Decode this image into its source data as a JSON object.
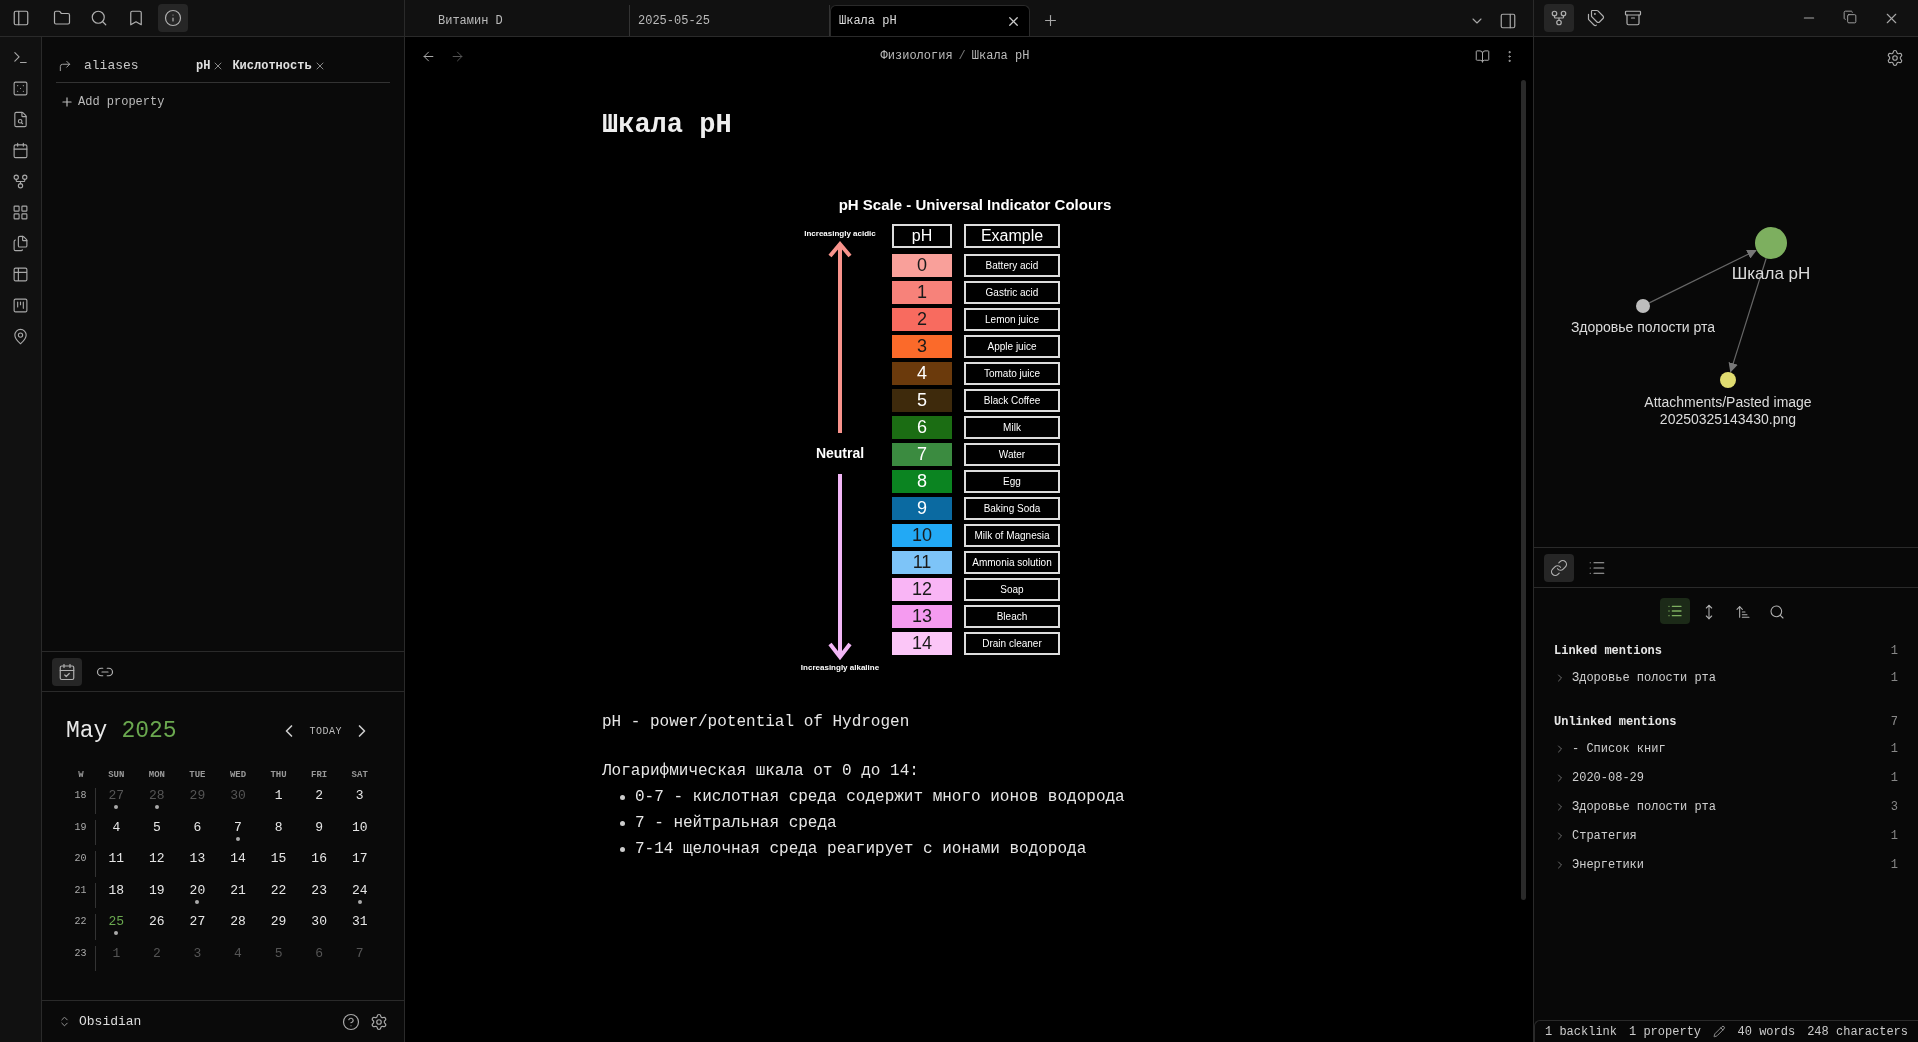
{
  "tabs": [
    {
      "label": "Витамин D",
      "selected": false
    },
    {
      "label": "2025-05-25",
      "selected": false
    },
    {
      "label": "Шкала pH",
      "selected": true
    }
  ],
  "breadcrumb": [
    "Физиология",
    "Шкала pH"
  ],
  "breadcrumb_separator": "/",
  "properties": {
    "name": "aliases",
    "values": [
      "pH",
      "Кислотность"
    ],
    "add_label": "Add property"
  },
  "note": {
    "title": "Шкала pH",
    "image": {
      "title": "pH Scale - Universal Indicator Colours",
      "headers": [
        "pH",
        "Example"
      ],
      "acid_label": "Increasingly acidic",
      "neutral_label": "Neutral",
      "alkaline_label": "Increasingly alkaline",
      "rows": [
        {
          "ph": "0",
          "example": "Battery acid",
          "color": "#f9a09a"
        },
        {
          "ph": "1",
          "example": "Gastric acid",
          "color": "#f7827a"
        },
        {
          "ph": "2",
          "example": "Lemon juice",
          "color": "#f86b5f"
        },
        {
          "ph": "3",
          "example": "Apple juice",
          "color": "#fb6a2a"
        },
        {
          "ph": "4",
          "example": "Tomato juice",
          "color": "#6b3a0c"
        },
        {
          "ph": "5",
          "example": "Black Coffee",
          "color": "#3e2a0c"
        },
        {
          "ph": "6",
          "example": "Milk",
          "color": "#1b6d13"
        },
        {
          "ph": "7",
          "example": "Water",
          "color": "#3b8b40"
        },
        {
          "ph": "8",
          "example": "Egg",
          "color": "#0b8421"
        },
        {
          "ph": "9",
          "example": "Baking Soda",
          "color": "#0b6aa1"
        },
        {
          "ph": "10",
          "example": "Milk of Magnesia",
          "color": "#22a9f5"
        },
        {
          "ph": "11",
          "example": "Ammonia solution",
          "color": "#7dc4f8"
        },
        {
          "ph": "12",
          "example": "Soap",
          "color": "#f9b5f5"
        },
        {
          "ph": "13",
          "example": "Bleach",
          "color": "#f59bf0"
        },
        {
          "ph": "14",
          "example": "Drain cleaner",
          "color": "#fbc6f7"
        }
      ]
    },
    "lines": [
      "pH - power/potential of Hydrogen",
      "Логарифмическая шкала от 0 до 14:"
    ],
    "bullets": [
      "0-7 - кислотная среда содержит много ионов водорода",
      "7 - нейтральная среда",
      "7-14 щелочная среда реагирует с ионами водорода"
    ]
  },
  "calendar": {
    "month": "May",
    "year": "2025",
    "today_label": "TODAY",
    "week_header": "W",
    "weekdays": [
      "SUN",
      "MON",
      "TUE",
      "WED",
      "THU",
      "FRI",
      "SAT"
    ],
    "weeks": [
      {
        "num": "18",
        "days": [
          {
            "label": "27",
            "muted": true,
            "dot": true,
            "today": false
          },
          {
            "label": "28",
            "muted": true,
            "dot": true,
            "today": false
          },
          {
            "label": "29",
            "muted": true,
            "dot": false,
            "today": false
          },
          {
            "label": "30",
            "muted": true,
            "dot": false,
            "today": false
          },
          {
            "label": "1",
            "muted": false,
            "dot": false,
            "today": false
          },
          {
            "label": "2",
            "muted": false,
            "dot": false,
            "today": false
          },
          {
            "label": "3",
            "muted": false,
            "dot": false,
            "today": false
          }
        ]
      },
      {
        "num": "19",
        "days": [
          {
            "label": "4",
            "muted": false,
            "dot": false,
            "today": false
          },
          {
            "label": "5",
            "muted": false,
            "dot": false,
            "today": false
          },
          {
            "label": "6",
            "muted": false,
            "dot": false,
            "today": false
          },
          {
            "label": "7",
            "muted": false,
            "dot": true,
            "today": false
          },
          {
            "label": "8",
            "muted": false,
            "dot": false,
            "today": false
          },
          {
            "label": "9",
            "muted": false,
            "dot": false,
            "today": false
          },
          {
            "label": "10",
            "muted": false,
            "dot": false,
            "today": false
          }
        ]
      },
      {
        "num": "20",
        "days": [
          {
            "label": "11",
            "muted": false,
            "dot": false,
            "today": false
          },
          {
            "label": "12",
            "muted": false,
            "dot": false,
            "today": false
          },
          {
            "label": "13",
            "muted": false,
            "dot": false,
            "today": false
          },
          {
            "label": "14",
            "muted": false,
            "dot": false,
            "today": false
          },
          {
            "label": "15",
            "muted": false,
            "dot": false,
            "today": false
          },
          {
            "label": "16",
            "muted": false,
            "dot": false,
            "today": false
          },
          {
            "label": "17",
            "muted": false,
            "dot": false,
            "today": false
          }
        ]
      },
      {
        "num": "21",
        "days": [
          {
            "label": "18",
            "muted": false,
            "dot": false,
            "today": false
          },
          {
            "label": "19",
            "muted": false,
            "dot": false,
            "today": false
          },
          {
            "label": "20",
            "muted": false,
            "dot": true,
            "today": false
          },
          {
            "label": "21",
            "muted": false,
            "dot": false,
            "today": false
          },
          {
            "label": "22",
            "muted": false,
            "dot": false,
            "today": false
          },
          {
            "label": "23",
            "muted": false,
            "dot": false,
            "today": false
          },
          {
            "label": "24",
            "muted": false,
            "dot": true,
            "today": false
          }
        ]
      },
      {
        "num": "22",
        "days": [
          {
            "label": "25",
            "muted": false,
            "dot": true,
            "today": true
          },
          {
            "label": "26",
            "muted": false,
            "dot": false,
            "today": false
          },
          {
            "label": "27",
            "muted": false,
            "dot": false,
            "today": false
          },
          {
            "label": "28",
            "muted": false,
            "dot": false,
            "today": false
          },
          {
            "label": "29",
            "muted": false,
            "dot": false,
            "today": false
          },
          {
            "label": "30",
            "muted": false,
            "dot": false,
            "today": false
          },
          {
            "label": "31",
            "muted": false,
            "dot": false,
            "today": false
          }
        ]
      },
      {
        "num": "23",
        "days": [
          {
            "label": "1",
            "muted": true,
            "dot": false,
            "today": false
          },
          {
            "label": "2",
            "muted": true,
            "dot": false,
            "today": false
          },
          {
            "label": "3",
            "muted": true,
            "dot": false,
            "today": false
          },
          {
            "label": "4",
            "muted": true,
            "dot": false,
            "today": false
          },
          {
            "label": "5",
            "muted": true,
            "dot": false,
            "today": false
          },
          {
            "label": "6",
            "muted": true,
            "dot": false,
            "today": false
          },
          {
            "label": "7",
            "muted": true,
            "dot": false,
            "today": false
          }
        ]
      }
    ]
  },
  "vault": "Obsidian",
  "graph": {
    "nodes": [
      {
        "label": "Шкала pH",
        "color": "#7daf5f"
      },
      {
        "label": "Здоровье полости рта",
        "color": "#bdbdbd"
      },
      {
        "label": "Attachments/Pasted image 20250325143430.png",
        "color": "#e0dc70"
      }
    ]
  },
  "backlinks": {
    "sections": [
      {
        "title": "Linked mentions",
        "count": "1",
        "items": [
          {
            "label": "Здоровье полости рта",
            "count": "1"
          }
        ]
      },
      {
        "title": "Unlinked mentions",
        "count": "7",
        "items": [
          {
            "label": "- Список книг",
            "count": "1"
          },
          {
            "label": "2020-08-29",
            "count": "1"
          },
          {
            "label": "Здоровье полости рта",
            "count": "3"
          },
          {
            "label": "Стратегия",
            "count": "1"
          },
          {
            "label": "Энергетики",
            "count": "1"
          }
        ]
      }
    ]
  },
  "status_bar": [
    "1 backlink",
    "1 property",
    "40 words",
    "248 characters"
  ]
}
